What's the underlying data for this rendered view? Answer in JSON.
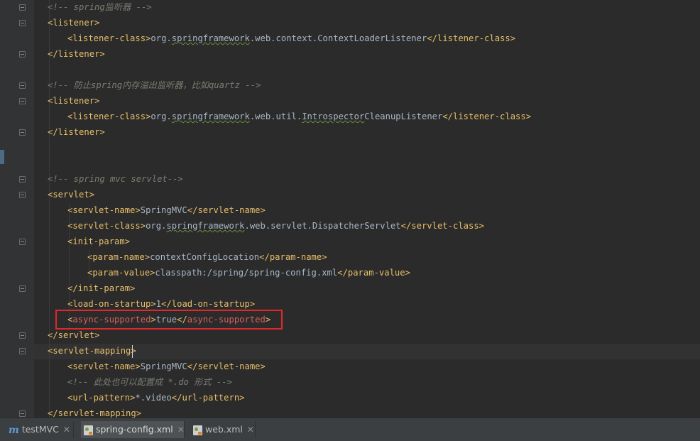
{
  "editor": {
    "lines": [
      [
        {
          "c": "cmt",
          "t": "<!-- spring监听器 -->"
        }
      ],
      [
        {
          "c": "tag",
          "t": "<listener>"
        }
      ],
      [
        {
          "c": "tag",
          "t": "<listener-class>"
        },
        {
          "c": "txt",
          "t": "org."
        },
        {
          "c": "txt uline",
          "t": "springframework"
        },
        {
          "c": "txt",
          "t": ".web.context.ContextLoaderListener"
        },
        {
          "c": "tag",
          "t": "</listener-class>"
        }
      ],
      [
        {
          "c": "tag",
          "t": "</listener>"
        }
      ],
      [],
      [
        {
          "c": "cmt",
          "t": "<!-- 防止spring内存溢出监听器，比如quartz -->"
        }
      ],
      [
        {
          "c": "tag",
          "t": "<listener>"
        }
      ],
      [
        {
          "c": "tag",
          "t": "<listener-class>"
        },
        {
          "c": "txt",
          "t": "org."
        },
        {
          "c": "txt uline",
          "t": "springframework"
        },
        {
          "c": "txt",
          "t": ".web.util."
        },
        {
          "c": "txt uline",
          "t": "Introspector"
        },
        {
          "c": "txt",
          "t": "CleanupListener"
        },
        {
          "c": "tag",
          "t": "</listener-class>"
        }
      ],
      [
        {
          "c": "tag",
          "t": "</listener>"
        }
      ],
      [],
      [],
      [
        {
          "c": "cmt",
          "t": "<!-- spring mvc servlet-->"
        }
      ],
      [
        {
          "c": "tag",
          "t": "<servlet>"
        }
      ],
      [
        {
          "c": "tag",
          "t": "<servlet-name>"
        },
        {
          "c": "txt",
          "t": "SpringMVC"
        },
        {
          "c": "tag",
          "t": "</servlet-name>"
        }
      ],
      [
        {
          "c": "tag",
          "t": "<servlet-class>"
        },
        {
          "c": "txt",
          "t": "org."
        },
        {
          "c": "txt uline",
          "t": "springframework"
        },
        {
          "c": "txt",
          "t": ".web.servlet.DispatcherServlet"
        },
        {
          "c": "tag",
          "t": "</servlet-class>"
        }
      ],
      [
        {
          "c": "tag",
          "t": "<init-param>"
        }
      ],
      [
        {
          "c": "tag",
          "t": "<param-name>"
        },
        {
          "c": "txt",
          "t": "contextConfigLocation"
        },
        {
          "c": "tag",
          "t": "</param-name>"
        }
      ],
      [
        {
          "c": "tag",
          "t": "<param-value>"
        },
        {
          "c": "txt",
          "t": "classpath:/spring/spring-config.xml"
        },
        {
          "c": "tag",
          "t": "</param-value>"
        }
      ],
      [
        {
          "c": "tag",
          "t": "</init-param>"
        }
      ],
      [
        {
          "c": "tag",
          "t": "<load-on-startup>"
        },
        {
          "c": "txt",
          "t": "1"
        },
        {
          "c": "tag",
          "t": "</load-on-startup>"
        }
      ],
      [
        {
          "c": "tag",
          "t": "<"
        },
        {
          "c": "tag-red",
          "t": "async-supported"
        },
        {
          "c": "tag",
          "t": ">"
        },
        {
          "c": "txt",
          "t": "true"
        },
        {
          "c": "tag",
          "t": "</"
        },
        {
          "c": "tag-red",
          "t": "async-supported"
        },
        {
          "c": "tag",
          "t": ">"
        }
      ],
      [
        {
          "c": "tag",
          "t": "</servlet>"
        }
      ],
      [
        {
          "c": "tag",
          "t": "<servlet-mapping>"
        }
      ],
      [
        {
          "c": "tag",
          "t": "<servlet-name>"
        },
        {
          "c": "txt",
          "t": "SpringMVC"
        },
        {
          "c": "tag",
          "t": "</servlet-name>"
        }
      ],
      [
        {
          "c": "cmt",
          "t": "<!-- 此处也可以配置成 *.do 形式 -->"
        }
      ],
      [
        {
          "c": "tag",
          "t": "<url-pattern>"
        },
        {
          "c": "txt",
          "t": "*.video"
        },
        {
          "c": "tag",
          "t": "</url-pattern>"
        }
      ],
      [
        {
          "c": "tag",
          "t": "</servlet-mapping>"
        }
      ]
    ]
  },
  "tabs": [
    {
      "label": "testMVC",
      "icon": "module-icon",
      "active": false
    },
    {
      "label": "spring-config.xml",
      "icon": "spring-xml-icon",
      "active": true
    },
    {
      "label": "web.xml",
      "icon": "xml-file-icon",
      "active": false
    }
  ],
  "tab_close_glyph": "✕",
  "colors": {
    "background": "#2b2b2b",
    "tag": "#e8bf6a",
    "comment": "#7a7e73",
    "text": "#a9b7c6",
    "highlight_border": "#e3272b"
  }
}
